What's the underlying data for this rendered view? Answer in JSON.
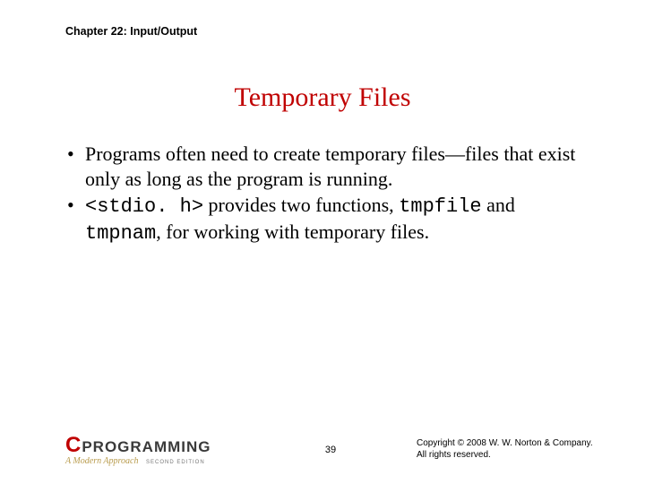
{
  "chapter_header": "Chapter 22: Input/Output",
  "title": "Temporary Files",
  "bullets": {
    "b1_pre": "Programs often need to create temporary files—files that exist only as long as the program is running.",
    "b2_code1": "<stdio. h>",
    "b2_mid1": " provides two functions, ",
    "b2_code2": "tmpfile",
    "b2_mid2": " and ",
    "b2_code3": "tmpnam",
    "b2_post": ", for working with temporary files."
  },
  "logo": {
    "c": "C",
    "prog": "PROGRAMMING",
    "sub": "A Modern Approach",
    "edition": "SECOND EDITION"
  },
  "page_number": "39",
  "copyright_line1": "Copyright © 2008 W. W. Norton & Company.",
  "copyright_line2": "All rights reserved."
}
